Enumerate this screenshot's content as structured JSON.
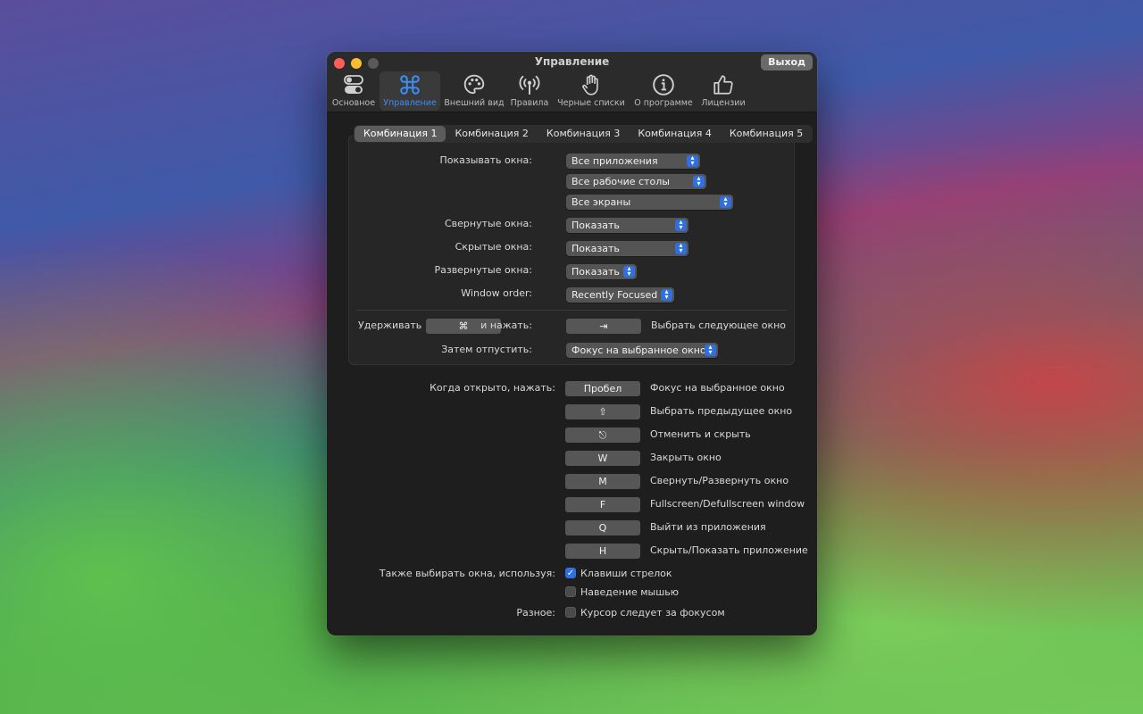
{
  "window": {
    "title": "Управление",
    "quit_label": "Выход"
  },
  "toolbar": [
    {
      "label": "Основное",
      "icon": "toggles-icon"
    },
    {
      "label": "Управление",
      "icon": "command-icon"
    },
    {
      "label": "Внешний вид",
      "icon": "palette-icon"
    },
    {
      "label": "Правила",
      "icon": "antenna-icon"
    },
    {
      "label": "Черные списки",
      "icon": "hand-icon"
    },
    {
      "label": "О программе",
      "icon": "info-icon"
    },
    {
      "label": "Лицензии",
      "icon": "thumbs-up-icon"
    }
  ],
  "tabs": [
    "Комбинация 1",
    "Комбинация 2",
    "Комбинация 3",
    "Комбинация 4",
    "Комбинация 5"
  ],
  "show_windows": {
    "label": "Показывать окна:",
    "apps": "Все приложения",
    "spaces": "Все рабочие столы",
    "screens": "Все экраны"
  },
  "minimized": {
    "label": "Свернутые окна:",
    "value": "Показать"
  },
  "hidden": {
    "label": "Скрытые окна:",
    "value": "Показать"
  },
  "fullscreen": {
    "label": "Развернутые окна:",
    "value": "Показать"
  },
  "window_order": {
    "label": "Window order:",
    "value": "Recently Focused"
  },
  "hold": {
    "label": "Удерживать",
    "key": "⌘",
    "and_press": "и нажать:",
    "press_key": "⇥",
    "action": "Выбрать следующее окно"
  },
  "then_release": {
    "label": "Затем отпустить:",
    "value": "Фокус на выбранное окно"
  },
  "when_open": {
    "label": "Когда открыто, нажать:",
    "shortcuts": [
      {
        "key": "Пробел",
        "action": "Фокус на выбранное окно"
      },
      {
        "key": "⇧",
        "action": "Выбрать предыдущее окно"
      },
      {
        "key": "⎋",
        "action": "Отменить и скрыть"
      },
      {
        "key": "W",
        "action": "Закрыть окно"
      },
      {
        "key": "M",
        "action": "Свернуть/Развернуть окно"
      },
      {
        "key": "F",
        "action": "Fullscreen/Defullscreen window"
      },
      {
        "key": "Q",
        "action": "Выйти из приложения"
      },
      {
        "key": "H",
        "action": "Скрыть/Показать приложение"
      }
    ]
  },
  "also_select": {
    "label": "Также выбирать окна, используя:",
    "arrow_keys": "Клавиши стрелок",
    "arrow_keys_checked": true,
    "mouse_hover": "Наведение мышью",
    "mouse_hover_checked": false
  },
  "misc": {
    "label": "Разное:",
    "cursor_follows": "Курсор следует за фокусом",
    "cursor_follows_checked": false
  },
  "colors": {
    "accent": "#2f6fdf",
    "active_tab_text": "#3d8df5"
  }
}
